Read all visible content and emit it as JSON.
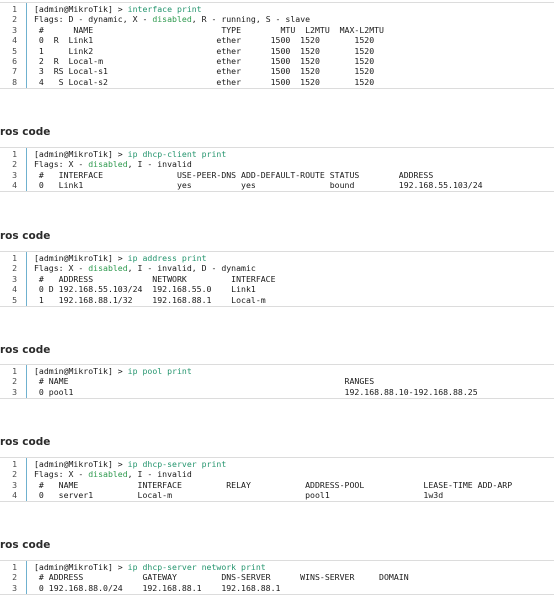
{
  "headings": [
    "ros code",
    "ros code",
    "ros code",
    "ros code",
    "ros code"
  ],
  "blocks": [
    {
      "lines": [
        {
          "n": "1",
          "parts": [
            {
              "t": "[admin@MikroTik] > "
            },
            {
              "t": "interface print",
              "c": "cmd"
            }
          ]
        },
        {
          "n": "2",
          "parts": [
            {
              "t": "Flags: D - dynamic, X - "
            },
            {
              "t": "disabled",
              "c": "dis"
            },
            {
              "t": ", R - running, S - slave"
            }
          ]
        },
        {
          "n": "3",
          "parts": [
            {
              "t": " #      NAME                          TYPE        MTU  L2MTU  MAX-L2MTU"
            }
          ]
        },
        {
          "n": "4",
          "parts": [
            {
              "t": " 0  R  Link1                         ether      1500  1520       1520"
            }
          ]
        },
        {
          "n": "5",
          "parts": [
            {
              "t": " 1     Link2                         ether      1500  1520       1520"
            }
          ]
        },
        {
          "n": "6",
          "parts": [
            {
              "t": " 2  R  Local-m                       ether      1500  1520       1520"
            }
          ]
        },
        {
          "n": "7",
          "parts": [
            {
              "t": " 3  RS Local-s1                      ether      1500  1520       1520"
            }
          ]
        },
        {
          "n": "8",
          "parts": [
            {
              "t": " 4   S Local-s2                      ether      1500  1520       1520"
            }
          ]
        }
      ]
    },
    {
      "lines": [
        {
          "n": "1",
          "parts": [
            {
              "t": "[admin@MikroTik] > "
            },
            {
              "t": "ip dhcp-client print",
              "c": "cmd"
            }
          ]
        },
        {
          "n": "2",
          "parts": [
            {
              "t": "Flags: X - "
            },
            {
              "t": "disabled",
              "c": "dis"
            },
            {
              "t": ", I - invalid"
            }
          ]
        },
        {
          "n": "3",
          "parts": [
            {
              "t": " #   INTERFACE               USE-PEER-DNS ADD-DEFAULT-ROUTE STATUS        ADDRESS"
            }
          ]
        },
        {
          "n": "4",
          "parts": [
            {
              "t": " 0   Link1                   yes          yes               bound         192.168.55.103/24"
            }
          ]
        }
      ]
    },
    {
      "lines": [
        {
          "n": "1",
          "parts": [
            {
              "t": "[admin@MikroTik] > "
            },
            {
              "t": "ip address print",
              "c": "cmd"
            }
          ]
        },
        {
          "n": "2",
          "parts": [
            {
              "t": "Flags: X - "
            },
            {
              "t": "disabled",
              "c": "dis"
            },
            {
              "t": ", I - invalid, D - dynamic"
            }
          ]
        },
        {
          "n": "3",
          "parts": [
            {
              "t": " #   ADDRESS            NETWORK         INTERFACE"
            }
          ]
        },
        {
          "n": "4",
          "parts": [
            {
              "t": " 0 D 192.168.55.103/24  192.168.55.0    Link1"
            }
          ]
        },
        {
          "n": "5",
          "parts": [
            {
              "t": " 1   192.168.88.1/32    192.168.88.1    Local-m"
            }
          ]
        }
      ]
    },
    {
      "lines": [
        {
          "n": "1",
          "parts": [
            {
              "t": "[admin@MikroTik] > "
            },
            {
              "t": "ip pool print",
              "c": "cmd"
            }
          ]
        },
        {
          "n": "2",
          "parts": [
            {
              "t": " # NAME                                                        RANGES"
            }
          ]
        },
        {
          "n": "3",
          "parts": [
            {
              "t": " 0 pool1                                                       192.168.88.10-192.168.88.25"
            }
          ]
        }
      ]
    },
    {
      "lines": [
        {
          "n": "1",
          "parts": [
            {
              "t": "[admin@MikroTik] > "
            },
            {
              "t": "ip dhcp-server print",
              "c": "cmd"
            }
          ]
        },
        {
          "n": "2",
          "parts": [
            {
              "t": "Flags: X - "
            },
            {
              "t": "disabled",
              "c": "dis"
            },
            {
              "t": ", I - invalid"
            }
          ]
        },
        {
          "n": "3",
          "parts": [
            {
              "t": " #   NAME            INTERFACE         RELAY           ADDRESS-POOL            LEASE-TIME ADD-ARP"
            }
          ]
        },
        {
          "n": "4",
          "parts": [
            {
              "t": " 0   server1         Local-m                           pool1                   1w3d"
            }
          ]
        }
      ]
    },
    {
      "lines": [
        {
          "n": "1",
          "parts": [
            {
              "t": "[admin@MikroTik] > "
            },
            {
              "t": "ip dhcp-server network print",
              "c": "cmd"
            }
          ]
        },
        {
          "n": "2",
          "parts": [
            {
              "t": " # ADDRESS            GATEWAY         DNS-SERVER      WINS-SERVER     DOMAIN"
            }
          ]
        },
        {
          "n": "3",
          "parts": [
            {
              "t": " 0 192.168.88.0/24    192.168.88.1    192.168.88.1"
            }
          ]
        }
      ]
    }
  ]
}
